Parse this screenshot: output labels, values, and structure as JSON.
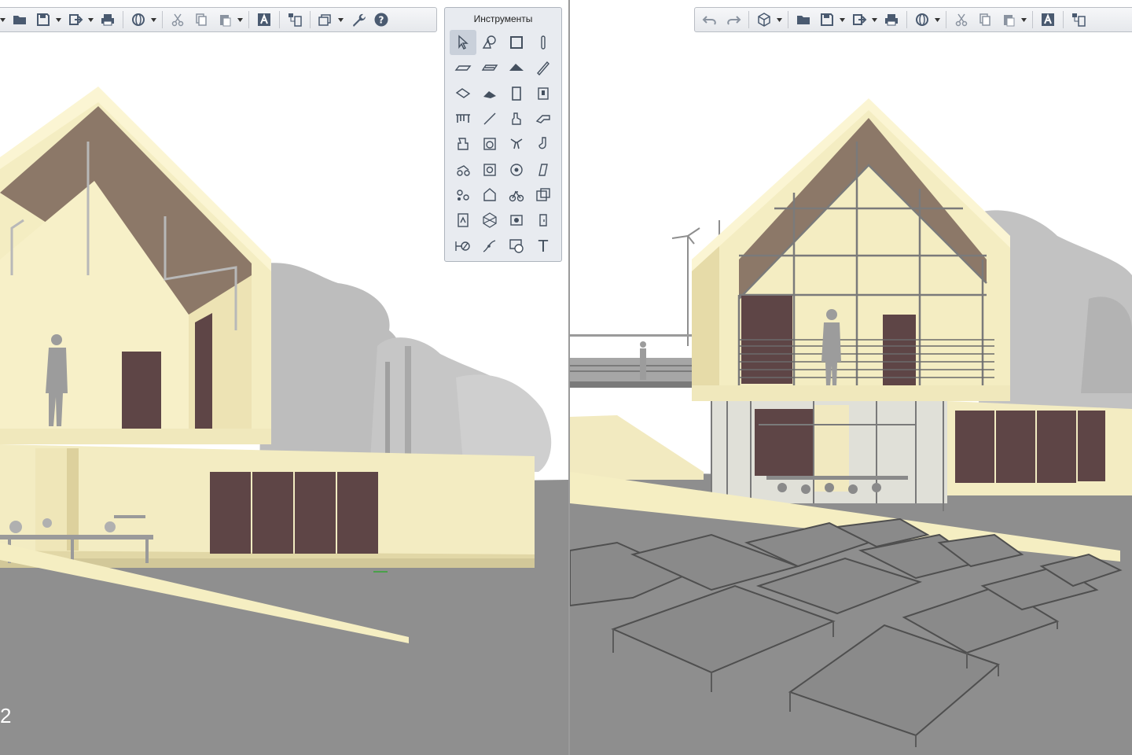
{
  "app": {
    "name": "3D architectural design application"
  },
  "left_viewport": {
    "name": "3D view (left)",
    "corner_label": "2",
    "toolbar": [
      {
        "icon": "chevron-down-icon",
        "label": "more"
      },
      {
        "icon": "folder-icon",
        "label": "Open"
      },
      {
        "icon": "save-icon",
        "label": "Save",
        "dropdown": true
      },
      {
        "icon": "export-icon",
        "label": "Export",
        "dropdown": true
      },
      {
        "icon": "print-icon",
        "label": "Print"
      },
      {
        "icon": "orbit-icon",
        "label": "Navigation",
        "dropdown": true
      },
      {
        "icon": "cut-icon",
        "label": "Cut"
      },
      {
        "icon": "copy-icon",
        "label": "Copy"
      },
      {
        "icon": "paste-icon",
        "label": "Paste",
        "dropdown": true
      },
      {
        "icon": "text-style-icon",
        "label": "Text"
      },
      {
        "icon": "layout-icon",
        "label": "Layout"
      },
      {
        "icon": "views-icon",
        "label": "Views",
        "dropdown": true
      },
      {
        "icon": "wrench-icon",
        "label": "Settings"
      },
      {
        "icon": "help-icon",
        "label": "Help"
      }
    ]
  },
  "right_viewport": {
    "name": "3D view (right)",
    "toolbar": [
      {
        "icon": "undo-icon",
        "label": "Undo"
      },
      {
        "icon": "redo-icon",
        "label": "Redo"
      },
      {
        "icon": "cube-view-icon",
        "label": "3D view",
        "dropdown": true
      },
      {
        "icon": "folder-icon",
        "label": "Open"
      },
      {
        "icon": "save-icon",
        "label": "Save",
        "dropdown": true
      },
      {
        "icon": "export-icon",
        "label": "Export",
        "dropdown": true
      },
      {
        "icon": "print-icon",
        "label": "Print"
      },
      {
        "icon": "orbit-icon",
        "label": "Navigation",
        "dropdown": true
      },
      {
        "icon": "cut-icon",
        "label": "Cut"
      },
      {
        "icon": "copy-icon",
        "label": "Copy"
      },
      {
        "icon": "paste-icon",
        "label": "Paste",
        "dropdown": true
      },
      {
        "icon": "text-style-icon",
        "label": "Text"
      },
      {
        "icon": "layout-icon",
        "label": "Layout"
      }
    ]
  },
  "tools_palette": {
    "title": "Инструменты",
    "text_tool_glyph": "T",
    "tools": [
      "arrow-select-icon",
      "object-select-icon",
      "window-icon",
      "column-icon",
      "wall-icon",
      "slab-icon",
      "roof-icon",
      "pencil-icon",
      "beam-icon",
      "stair-icon",
      "door-icon",
      "cabinet-icon",
      "railing-icon",
      "line-icon",
      "figure-icon",
      "pipe-icon",
      "fixture-icon",
      "appliance-icon",
      "plant-icon",
      "lamp-icon",
      "vehicle-icon",
      "equipment-icon",
      "gear-object-icon",
      "curtain-icon",
      "group-icon",
      "house-object-icon",
      "bike-icon",
      "camera-icon",
      "library-icon",
      "polyhedron-icon",
      "render-icon",
      "opening-icon",
      "dimension-icon",
      "curve-icon",
      "hatch-icon",
      "text-tool-icon"
    ]
  },
  "colors": {
    "wall_cream": "#f5eec2",
    "wall_shadow": "#e8dca8",
    "roof_brown": "#8c7868",
    "door_brown": "#5e4546",
    "ground_gray": "#8f8f8f",
    "tree_gray": "#bdbdbd",
    "toolbar_bg": "#eceef1"
  }
}
